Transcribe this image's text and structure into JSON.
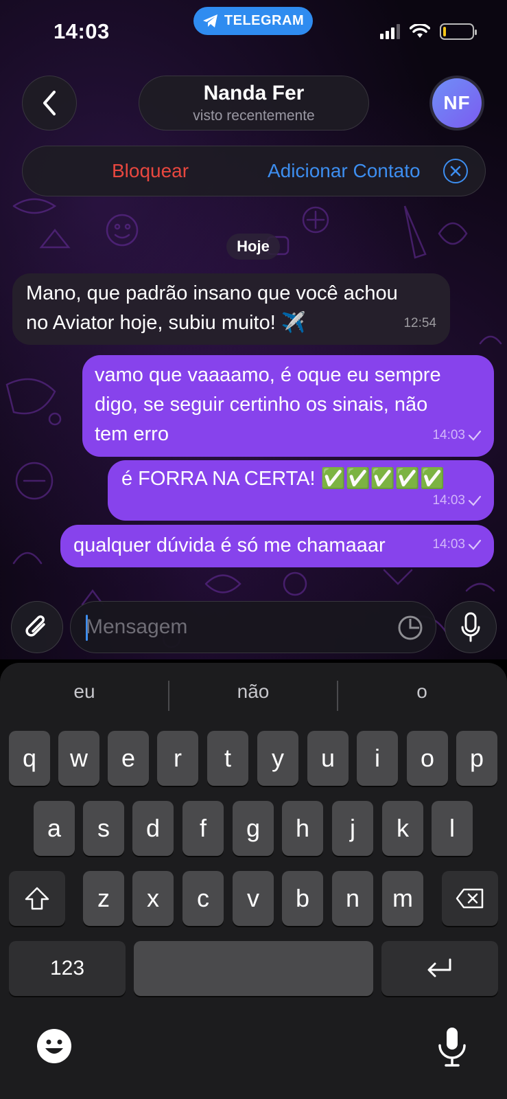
{
  "status_bar": {
    "time": "14:03",
    "app_badge": "TELEGRAM"
  },
  "header": {
    "chat_name": "Nanda Fer",
    "chat_status": "visto recentemente",
    "avatar_initials": "NF",
    "avatar_color": "#6f8ff7"
  },
  "action_bar": {
    "block_label": "Bloquear",
    "add_contact_label": "Adicionar Contato"
  },
  "date_chip": "Hoje",
  "messages": [
    {
      "direction": "in",
      "lines": [
        "Mano, que padrão insano que você achou",
        "no Aviator hoje, subiu muito! ✈️"
      ],
      "time": "12:54"
    },
    {
      "direction": "out",
      "lines": [
        "vamo que vaaaamo, é oque eu sempre",
        "digo, se seguir certinho os sinais, não",
        "tem erro"
      ],
      "time": "14:03"
    },
    {
      "direction": "out",
      "lines": [
        "é FORRA NA CERTA! ✅✅✅✅✅"
      ],
      "time": "14:03"
    },
    {
      "direction": "out",
      "lines": [
        "qualquer dúvida é só me chamaaar"
      ],
      "time": "14:03"
    }
  ],
  "composer": {
    "placeholder": "Mensagem"
  },
  "keyboard": {
    "suggestions": [
      "eu",
      "não",
      "o"
    ],
    "row1": [
      "q",
      "w",
      "e",
      "r",
      "t",
      "y",
      "u",
      "i",
      "o",
      "p"
    ],
    "row2": [
      "a",
      "s",
      "d",
      "f",
      "g",
      "h",
      "j",
      "k",
      "l"
    ],
    "row3": [
      "z",
      "x",
      "c",
      "v",
      "b",
      "n",
      "m"
    ],
    "numbers_label": "123"
  },
  "colors": {
    "outgoing_bubble": "#8743ec",
    "incoming_bubble": "#251f2b",
    "accent_blue": "#3d8ef0",
    "danger_red": "#e8473f"
  }
}
